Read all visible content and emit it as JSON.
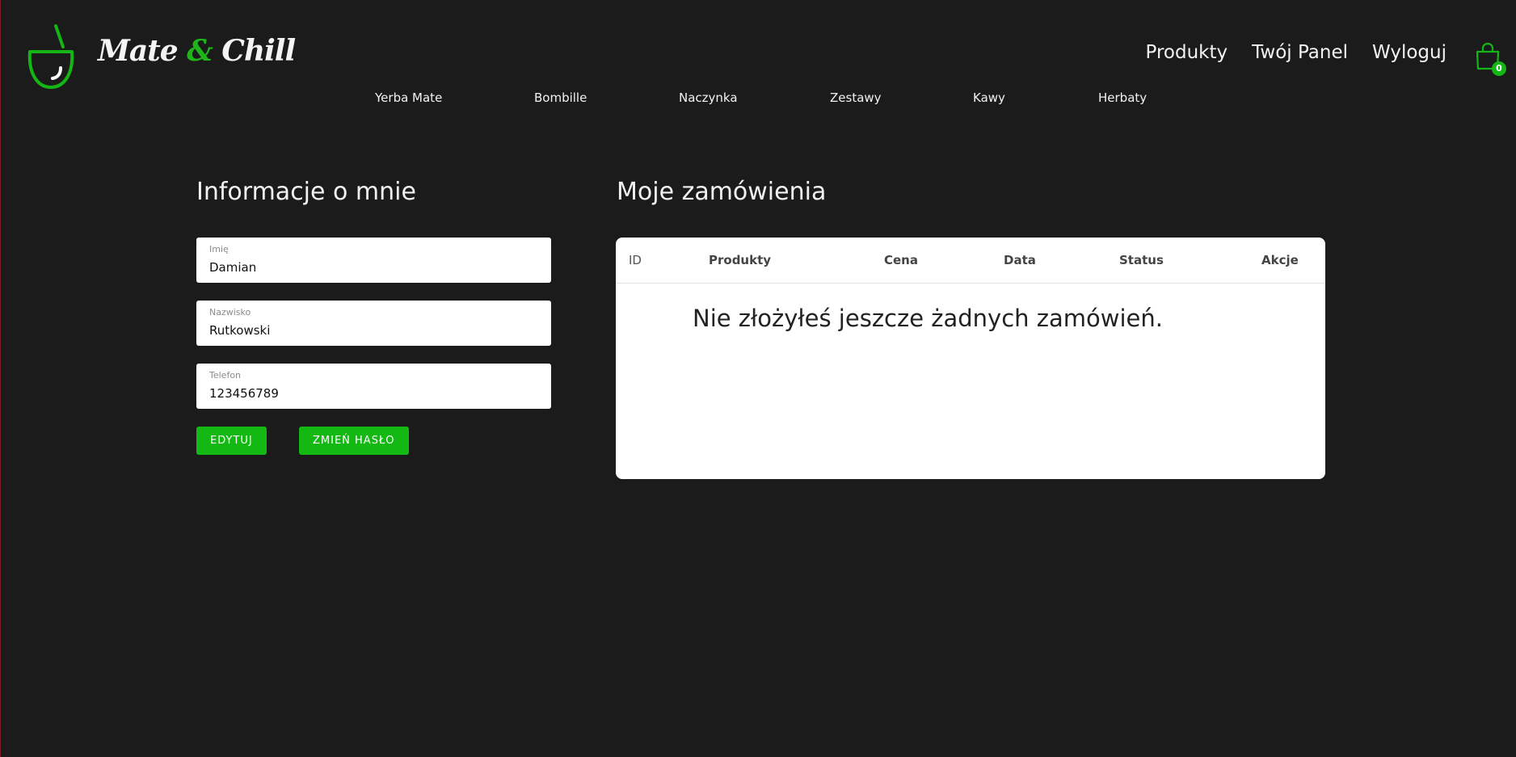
{
  "brand": {
    "name_part1": "Mate ",
    "amp": "&",
    "name_part2": " Chill"
  },
  "top_nav": {
    "products": "Produkty",
    "panel": "Twój Panel",
    "logout": "Wyloguj"
  },
  "cart": {
    "count": "0",
    "icon": "shopping-bag-icon"
  },
  "categories": [
    "Yerba Mate",
    "Bombille",
    "Naczynka",
    "Zestawy",
    "Kawy",
    "Herbaty"
  ],
  "profile": {
    "title": "Informacje o mnie",
    "fields": [
      {
        "label": "Imię",
        "value": "Damian"
      },
      {
        "label": "Nazwisko",
        "value": "Rutkowski"
      },
      {
        "label": "Telefon",
        "value": "123456789"
      }
    ],
    "edit_button": "Edytuj",
    "change_password_button": "Zmień hasło"
  },
  "orders": {
    "title": "Moje zamówienia",
    "columns": [
      "ID",
      "Produkty",
      "Cena",
      "Data",
      "Status",
      "Akcje"
    ],
    "empty_message": "Nie złożyłeś jeszcze żadnych zamówień."
  },
  "colors": {
    "background": "#1b1b1c",
    "accent": "#13b812",
    "text": "#f2f2f2"
  }
}
